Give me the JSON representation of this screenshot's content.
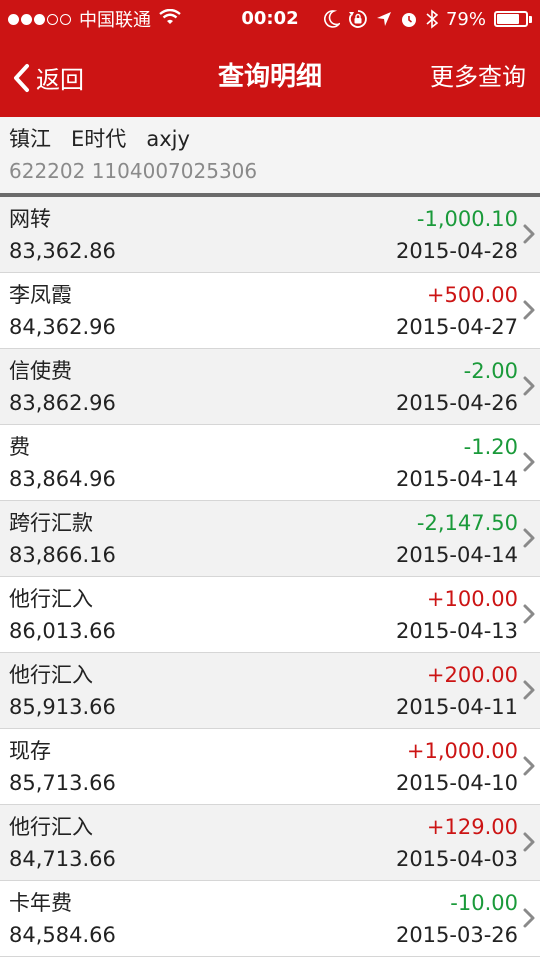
{
  "status_bar": {
    "carrier": "中国联通",
    "time": "00:02",
    "battery": "79%",
    "battery_level": 0.79,
    "icons": [
      "signal-dots",
      "wifi-icon",
      "moon-icon",
      "rotation-lock-icon",
      "location-arrow-icon",
      "alarm-icon",
      "bluetooth-icon",
      "battery-icon"
    ]
  },
  "nav": {
    "back_label": "返回",
    "title": "查询明细",
    "more_label": "更多查询"
  },
  "account": {
    "name": "镇江   E时代   axjy",
    "number": "622202 1104007025306"
  },
  "colors": {
    "brand_red": "#cc1414",
    "debit_green": "#1a9a3a",
    "credit_red": "#cc1414"
  },
  "transactions": [
    {
      "desc": "网转",
      "balance": "83,362.86",
      "amount": "-1,000.10",
      "date": "2015-04-28"
    },
    {
      "desc": "李凤霞",
      "balance": "84,362.96",
      "amount": "+500.00",
      "date": "2015-04-27"
    },
    {
      "desc": "信使费",
      "balance": "83,862.96",
      "amount": "-2.00",
      "date": "2015-04-26"
    },
    {
      "desc": "费",
      "balance": "83,864.96",
      "amount": "-1.20",
      "date": "2015-04-14"
    },
    {
      "desc": "跨行汇款",
      "balance": "83,866.16",
      "amount": "-2,147.50",
      "date": "2015-04-14"
    },
    {
      "desc": "他行汇入",
      "balance": "86,013.66",
      "amount": "+100.00",
      "date": "2015-04-13"
    },
    {
      "desc": "他行汇入",
      "balance": "85,913.66",
      "amount": "+200.00",
      "date": "2015-04-11"
    },
    {
      "desc": "现存",
      "balance": "85,713.66",
      "amount": "+1,000.00",
      "date": "2015-04-10"
    },
    {
      "desc": "他行汇入",
      "balance": "84,713.66",
      "amount": "+129.00",
      "date": "2015-04-03"
    },
    {
      "desc": "卡年费",
      "balance": "84,584.66",
      "amount": "-10.00",
      "date": "2015-03-26"
    }
  ]
}
